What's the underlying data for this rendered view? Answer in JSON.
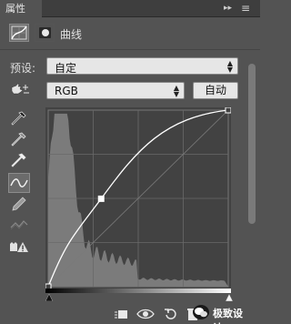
{
  "panel": {
    "tab_title": "属性",
    "close_glyph": "×",
    "collapse_glyph": "▸▸",
    "menu_glyph": "≡"
  },
  "header": {
    "title": "曲线",
    "icons": [
      "curves-adjustment-icon",
      "layer-mask-icon"
    ]
  },
  "preset": {
    "label": "预设:",
    "value": "自定"
  },
  "channel": {
    "value": "RGB",
    "auto_label": "自动"
  },
  "tools": [
    "on-image-adjust-hand-icon",
    "sample-black-point-eyedropper-icon",
    "sample-gray-point-eyedropper-icon",
    "sample-white-point-eyedropper-icon",
    "edit-points-curve-icon",
    "draw-pencil-icon",
    "smooth-curve-icon",
    "clipping-warning-icon"
  ],
  "curve": {
    "points": [
      [
        0,
        0
      ],
      [
        75,
        127
      ],
      [
        255,
        255
      ]
    ],
    "range": [
      0,
      255
    ]
  },
  "bottombar": {
    "icons": [
      "clip-to-layer-icon",
      "toggle-visibility-eye-icon",
      "reset-icon",
      "delete-trash-icon"
    ]
  },
  "watermark": {
    "text": "极致设计"
  },
  "colors": {
    "panel_bg": "#535353",
    "graph_bg": "#424242",
    "histogram": "#8f8f8f",
    "curve": "#ffffff"
  }
}
